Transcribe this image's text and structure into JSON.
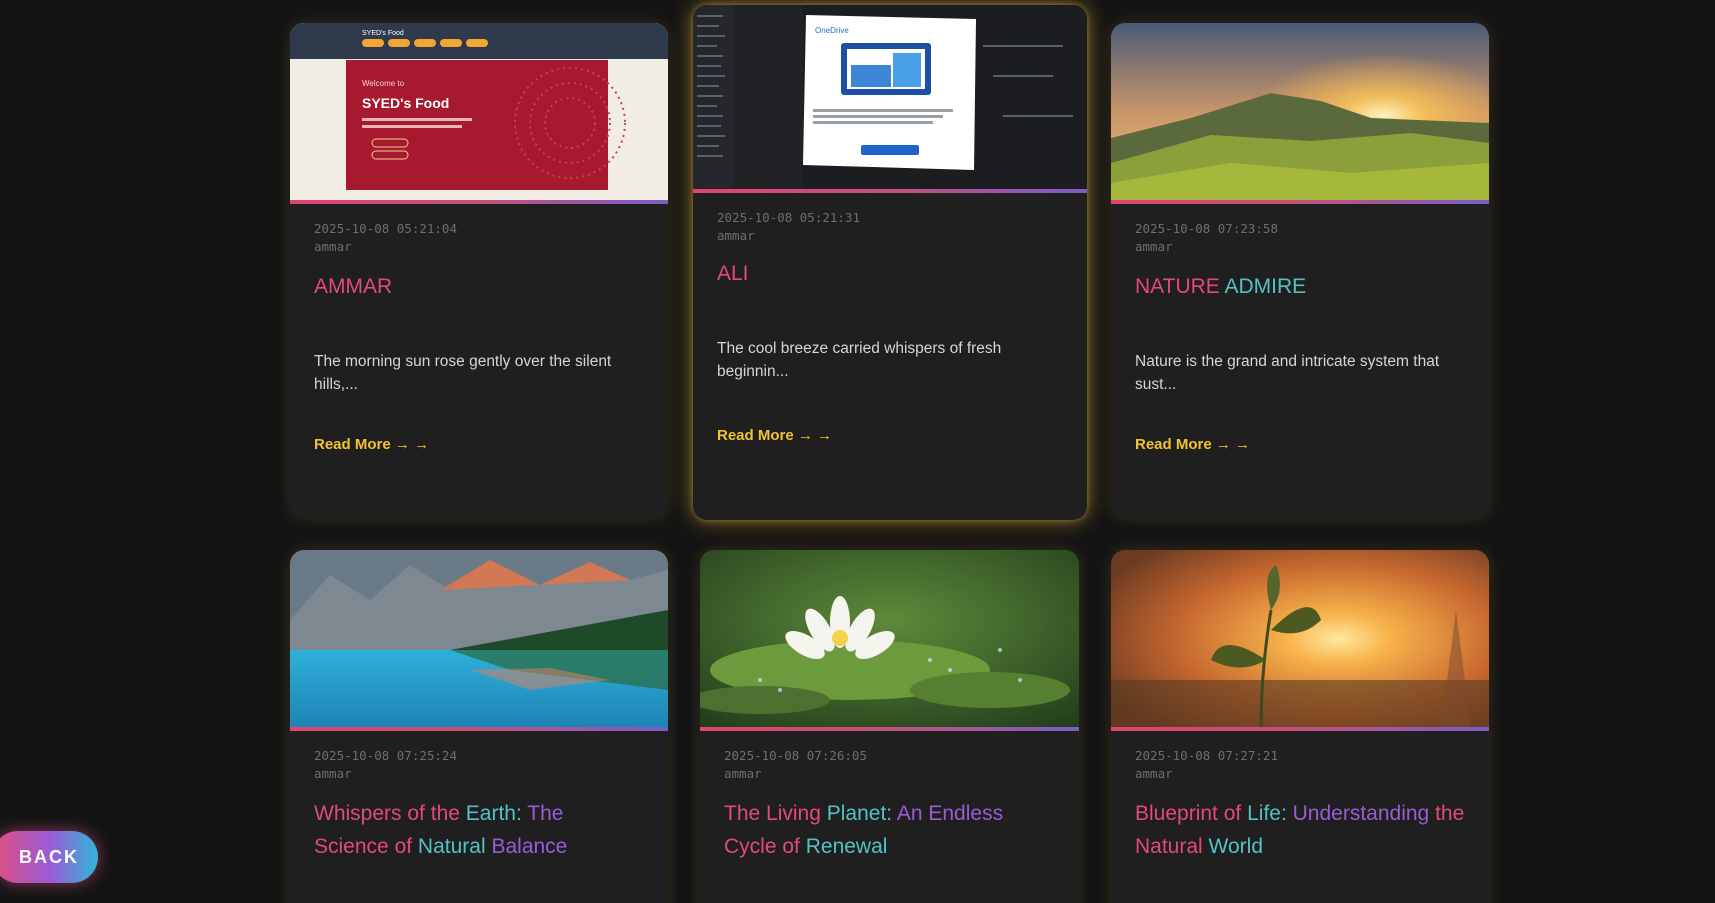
{
  "cards": [
    {
      "date": "2025-10-08 05:21:04",
      "author": "ammar",
      "title": "AMMAR",
      "excerpt": "The morning sun rose gently over the silent hills,...",
      "read_more": "Read More → →",
      "thumb_text": {
        "brand": "SYED's Food",
        "welcome": "Welcome to",
        "heading": "SYED's Food"
      }
    },
    {
      "date": "2025-10-08 05:21:31",
      "author": "ammar",
      "title": "ALI",
      "excerpt": "The cool breeze carried whispers of fresh beginnin...",
      "read_more": "Read More → →",
      "thumb_text": {
        "app": "OneDrive"
      }
    },
    {
      "date": "2025-10-08 07:23:58",
      "author": "ammar",
      "title_parts": [
        "NATURE",
        "ADMIRE"
      ],
      "excerpt": "Nature is the grand and intricate system that sust...",
      "read_more": "Read More → →"
    },
    {
      "date": "2025-10-08 07:25:24",
      "author": "ammar",
      "title_parts": [
        "Whispers",
        "of",
        "the",
        "Earth:",
        "The",
        "Science",
        "of",
        "Natural",
        "Balance"
      ]
    },
    {
      "date": "2025-10-08 07:26:05",
      "author": "ammar",
      "title_parts": [
        "The",
        "Living",
        "Planet:",
        "An",
        "Endless",
        "Cycle",
        "of",
        "Renewal"
      ]
    },
    {
      "date": "2025-10-08 07:27:21",
      "author": "ammar",
      "title_parts": [
        "Blueprint",
        "of",
        "Life:",
        "Understanding",
        "the",
        "Natural",
        "World"
      ]
    }
  ],
  "back_button": "BACK",
  "colors": {
    "accent_pink": "#e4497a",
    "accent_teal": "#53c2c6",
    "accent_purple": "#9a5cd6",
    "read_more": "#f2c230",
    "background": "#141414",
    "card": "#1f1f1f"
  }
}
